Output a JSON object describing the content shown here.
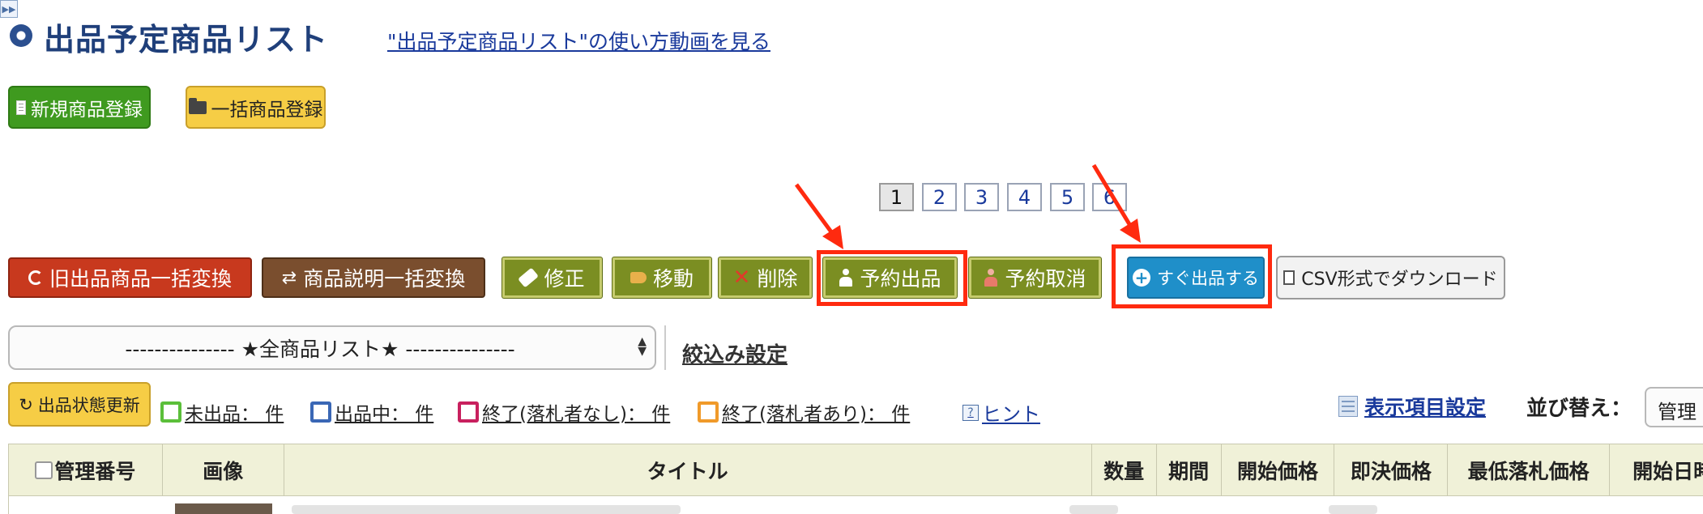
{
  "header": {
    "title": "出品予定商品リスト",
    "video_link": "\"出品予定商品リスト\"の使い方動画を見る"
  },
  "top_buttons": {
    "new_product": "新規商品登録",
    "bulk_register": "一括商品登録"
  },
  "pagination": {
    "pages": [
      "1",
      "2",
      "3",
      "4",
      "5",
      "6"
    ],
    "current": "1",
    "next_icon": "next-page-icon"
  },
  "actions": {
    "old_convert": "旧出品商品一括変換",
    "desc_convert": "商品説明一括変換",
    "edit": "修正",
    "move": "移動",
    "delete": "削除",
    "reserve": "予約出品",
    "reserve_cancel": "予約取消",
    "list_now": "すぐ出品する",
    "csv": "CSV形式でダウンロード"
  },
  "list_select": {
    "value": "--------------- ★全商品リスト★ ---------------"
  },
  "filter_link": "絞込み設定",
  "status_row": {
    "refresh": "出品状態更新",
    "unlisted": "未出品： 件",
    "listing": "出品中： 件",
    "ended_no_bid": "終了(落札者なし)： 件",
    "ended_bid": "終了(落札者あり)： 件",
    "hint": "ヒント",
    "display_settings": "表示項目設定",
    "sort_label": "並び替え：",
    "sort_value": "管理"
  },
  "status_colors": {
    "unlisted": "#5bbf3a",
    "listing": "#3a67b5",
    "ended_no_bid": "#c8205e",
    "ended_bid": "#f09a2a"
  },
  "accent": {
    "highlight_red": "#ff2a0f"
  },
  "table": {
    "columns": [
      "管理番号",
      "画像",
      "タイトル",
      "数量",
      "期間",
      "開始価格",
      "即決価格",
      "最低落札価格",
      "開始日時"
    ]
  }
}
